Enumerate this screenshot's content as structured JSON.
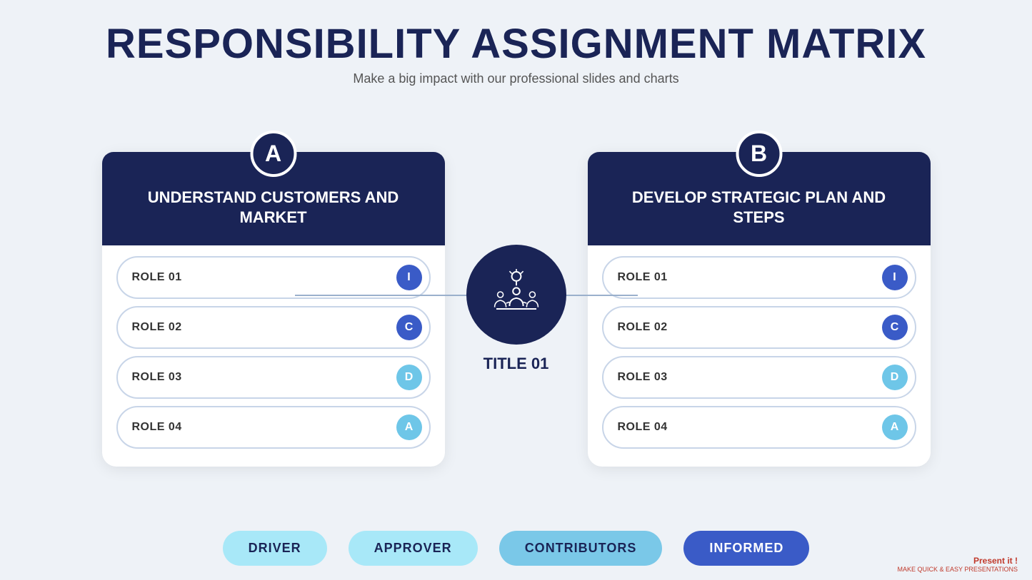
{
  "header": {
    "main_title": "RESPONSIBILITY ASSIGNMENT MATRIX",
    "subtitle": "Make a big impact with our professional slides and charts"
  },
  "card_a": {
    "letter": "A",
    "title": "UNDERSTAND CUSTOMERS AND MARKET",
    "roles": [
      {
        "label": "ROLE 01",
        "badge": "I",
        "badge_class": "badge-i"
      },
      {
        "label": "ROLE 02",
        "badge": "C",
        "badge_class": "badge-c"
      },
      {
        "label": "ROLE 03",
        "badge": "D",
        "badge_class": "badge-d"
      },
      {
        "label": "ROLE 04",
        "badge": "A",
        "badge_class": "badge-a"
      }
    ]
  },
  "card_b": {
    "letter": "B",
    "title": "DEVELOP STRATEGIC PLAN AND STEPS",
    "roles": [
      {
        "label": "ROLE 01",
        "badge": "I",
        "badge_class": "badge-i"
      },
      {
        "label": "ROLE 02",
        "badge": "C",
        "badge_class": "badge-c"
      },
      {
        "label": "ROLE 03",
        "badge": "D",
        "badge_class": "badge-d"
      },
      {
        "label": "ROLE 04",
        "badge": "A",
        "badge_class": "badge-a"
      }
    ]
  },
  "center": {
    "title": "TITLE 01"
  },
  "footer": {
    "items": [
      {
        "label": "DRIVER",
        "class": "footer-badge-driver"
      },
      {
        "label": "APPROVER",
        "class": "footer-badge-approver"
      },
      {
        "label": "CONTRIBUTORS",
        "class": "footer-badge-contributors"
      },
      {
        "label": "INFORMED",
        "class": "footer-badge-informed"
      }
    ]
  },
  "logo": {
    "line1": "Present it !",
    "line2": "MAKE QUICK & EASY PRESENTATIONS"
  }
}
